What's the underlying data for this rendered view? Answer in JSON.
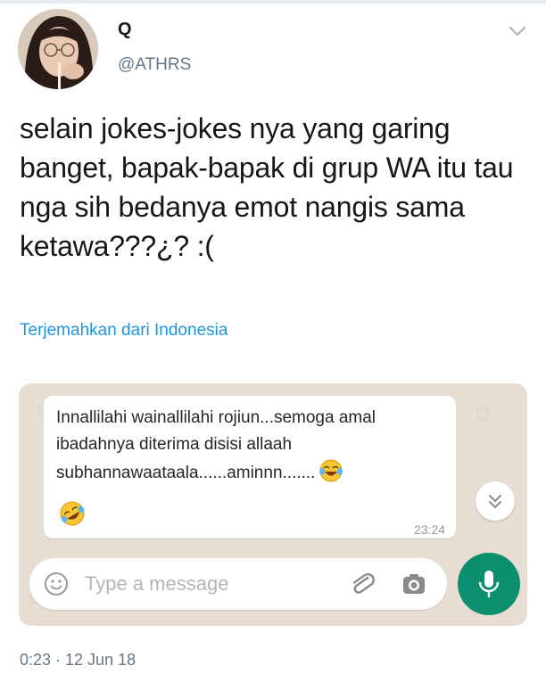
{
  "tweet": {
    "display_name": "Q",
    "handle": "@ATHRS",
    "text": "selain jokes-jokes nya yang garing banget, bapak-bapak di grup WA itu tau nga sih bedanya emot nangis sama ketawa???¿? :(",
    "translate_label": "Terjemahkan dari Indonesia",
    "timestamp": "0:23 · 12 Jun 18",
    "colors": {
      "link": "#1b95e0",
      "secondary_text": "#657786"
    }
  },
  "whatsapp": {
    "message_text": "Innallilahi wainallilahi rojiun...semoga amal ibadahnya diterima disisi allaah subhannawaataala......aminnn.......",
    "message_time": "23:24",
    "emojis": [
      "face-with-tears-of-joy-icon",
      "rolling-on-floor-laughing-icon"
    ],
    "input_placeholder": "Type a message",
    "colors": {
      "mic_button": "#0b8f6e",
      "wallpaper": "#e8ddd3"
    }
  }
}
